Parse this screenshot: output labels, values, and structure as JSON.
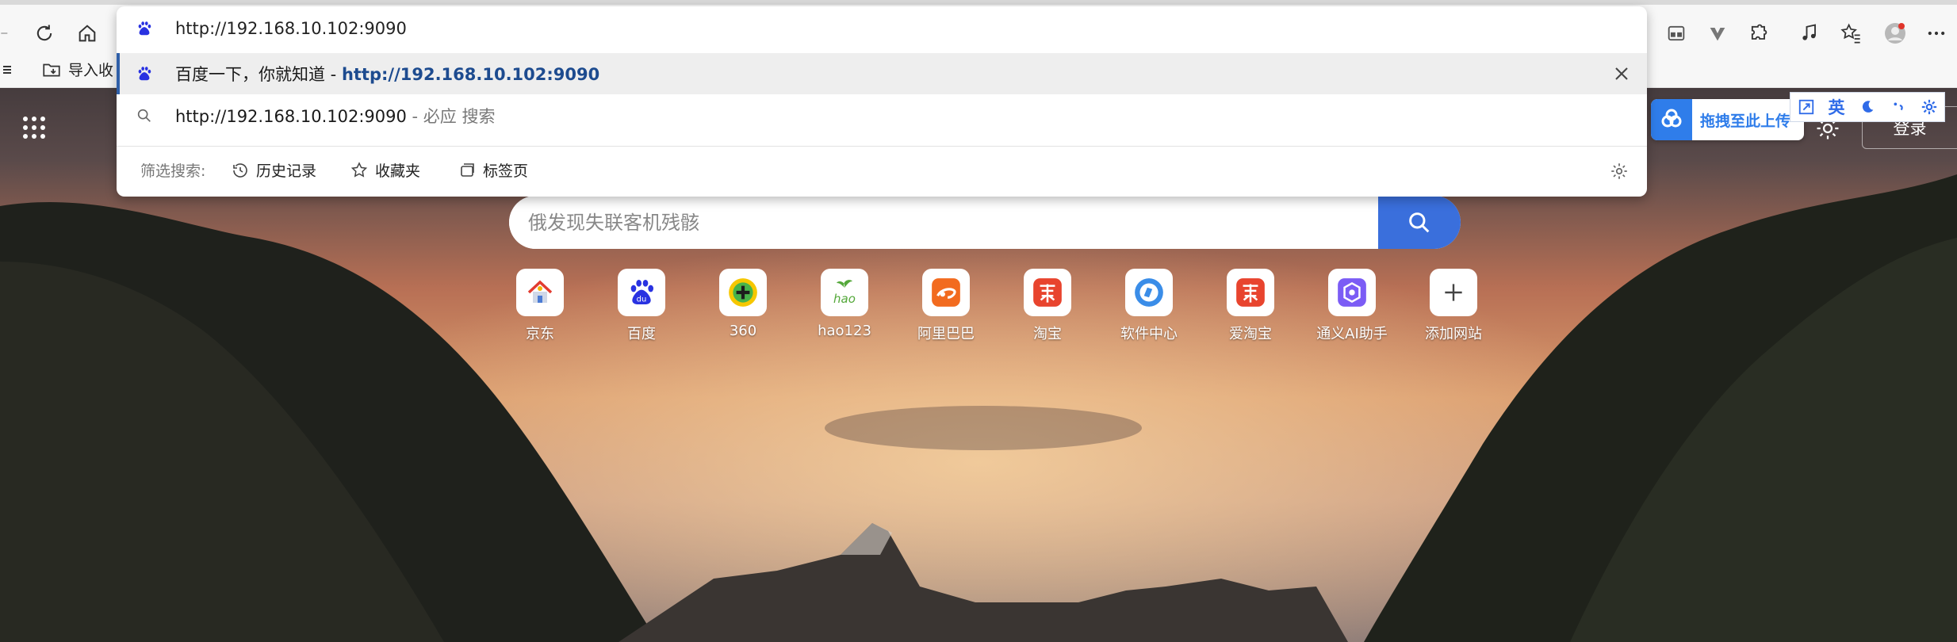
{
  "browser": {
    "address_url": "http://192.168.10.102:9090",
    "favorites_import_label": "导入收",
    "search_placeholder": "俄发现失联客机残骸"
  },
  "omnibox": {
    "input_value": "http://192.168.10.102:9090",
    "suggestion_1_title": "百度一下，你就知道 - ",
    "suggestion_1_url": "http://192.168.10.102:9090",
    "suggestion_2_url": "http://192.168.10.102:9090",
    "suggestion_2_suffix": " - 必应 搜索",
    "filter_label": "筛选搜索:",
    "filters": [
      "历史记录",
      "收藏夹",
      "标签页"
    ]
  },
  "page": {
    "upload_label": "拖拽至此上传",
    "ime_mode": "英",
    "login_label": "登录",
    "shortcuts": [
      {
        "label": "京东",
        "icon": "jd-house-icon"
      },
      {
        "label": "百度",
        "icon": "baidu-paw-icon"
      },
      {
        "label": "360",
        "icon": "360-icon"
      },
      {
        "label": "hao123",
        "icon": "hao123-icon"
      },
      {
        "label": "阿里巴巴",
        "icon": "alibaba-icon"
      },
      {
        "label": "淘宝",
        "icon": "taobao-icon"
      },
      {
        "label": "软件中心",
        "icon": "software-center-icon"
      },
      {
        "label": "爱淘宝",
        "icon": "ai-taobao-icon"
      },
      {
        "label": "通义AI助手",
        "icon": "tongyi-icon"
      },
      {
        "label": "添加网站",
        "icon": "plus-icon"
      }
    ]
  },
  "colors": {
    "accent": "#3a6fdc",
    "suggest_url": "#1d4b8f",
    "taobao_red": "#e8442e",
    "alibaba_orange": "#f26b1f"
  }
}
